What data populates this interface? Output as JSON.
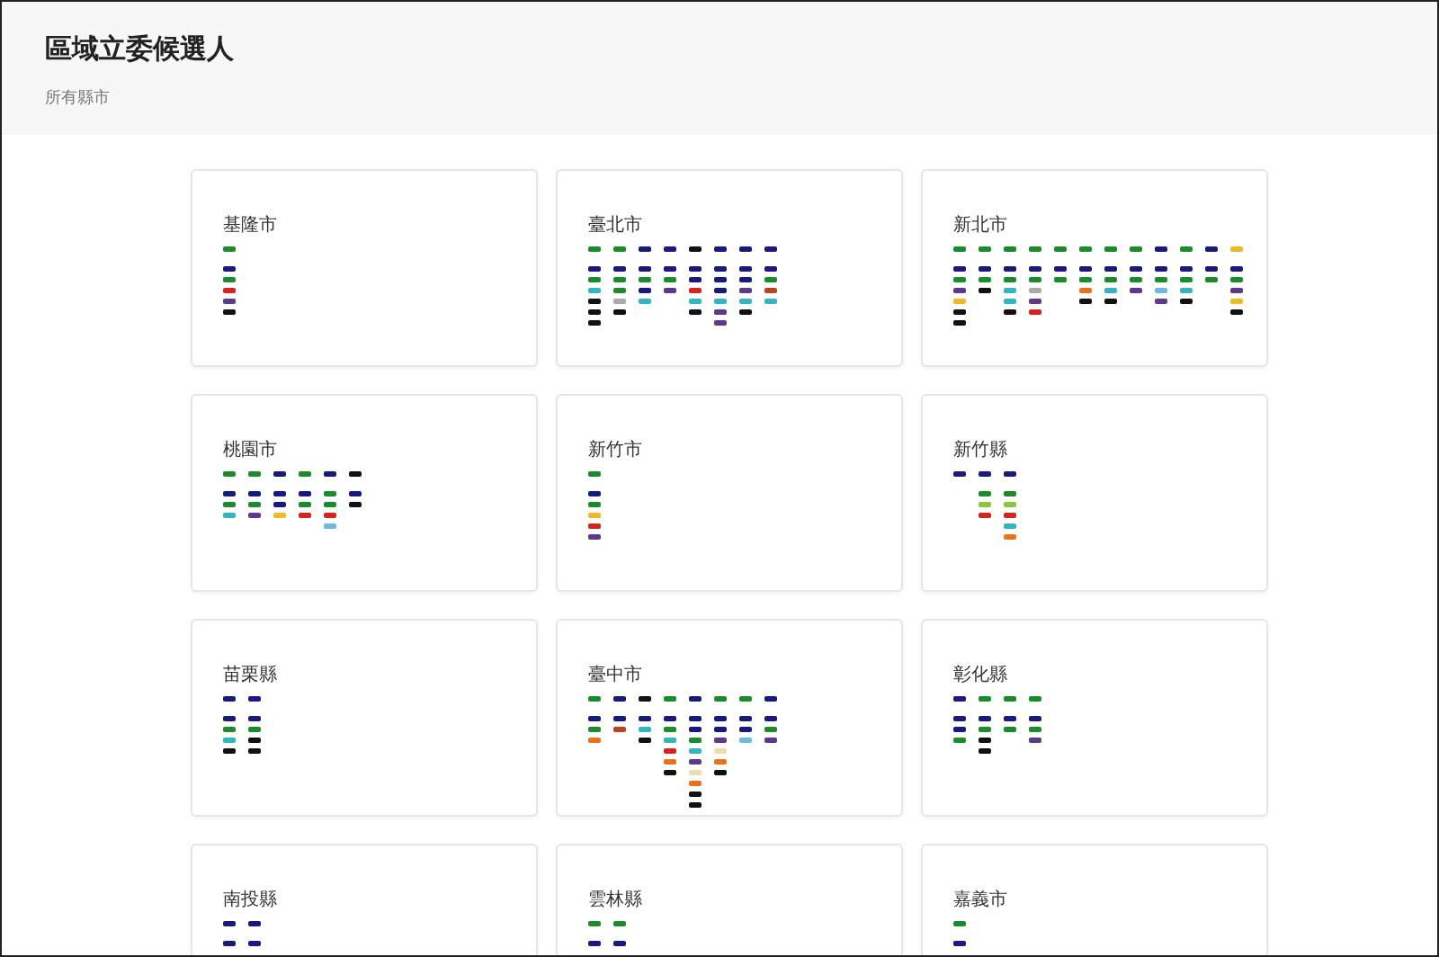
{
  "header": {
    "title": "區域立委候選人",
    "subtitle": "所有縣市"
  },
  "regions": [
    {
      "name": "基隆市",
      "columns": [
        [
          {
            "color": "#1e8a2e"
          },
          {
            "color": "#1a1a7a"
          },
          {
            "color": "#1e8a2e"
          },
          {
            "color": "#d0261d"
          },
          {
            "color": "#5b3a8c"
          },
          {
            "color": "#111111"
          }
        ]
      ]
    },
    {
      "name": "臺北市",
      "columns": [
        [
          {
            "color": "#1e8a2e"
          },
          {
            "color": "#1a1a7a"
          },
          {
            "color": "#1e8a2e"
          },
          {
            "color": "#35b5c0"
          },
          {
            "color": "#111111"
          },
          {
            "color": "#111111"
          },
          {
            "color": "#111111"
          }
        ],
        [
          {
            "color": "#1e8a2e"
          },
          {
            "color": "#1a1a7a"
          },
          {
            "color": "#1e8a2e"
          },
          {
            "color": "#1e8a2e"
          },
          {
            "color": "#aaaaaa"
          },
          {
            "color": "#111111"
          }
        ],
        [
          {
            "color": "#1a1a7a"
          },
          {
            "color": "#1a1a7a"
          },
          {
            "color": "#1e8a2e"
          },
          {
            "color": "#1a1a7a"
          },
          {
            "color": "#35b5c0"
          }
        ],
        [
          {
            "color": "#1a1a7a"
          },
          {
            "color": "#1a1a7a"
          },
          {
            "color": "#1e8a2e"
          },
          {
            "color": "#5b3a8c"
          }
        ],
        [
          {
            "color": "#111111"
          },
          {
            "color": "#1a1a7a"
          },
          {
            "color": "#1a1a7a"
          },
          {
            "color": "#d0261d"
          },
          {
            "color": "#35b5c0"
          },
          {
            "color": "#111111"
          }
        ],
        [
          {
            "color": "#1a1a7a"
          },
          {
            "color": "#1a1a7a"
          },
          {
            "color": "#1a1a7a"
          },
          {
            "color": "#1a1a7a"
          },
          {
            "color": "#35b5c0"
          },
          {
            "color": "#5b3a8c"
          },
          {
            "color": "#5b3a8c"
          }
        ],
        [
          {
            "color": "#1a1a7a"
          },
          {
            "color": "#1a1a7a"
          },
          {
            "color": "#1a1a7a"
          },
          {
            "color": "#5b3a8c"
          },
          {
            "color": "#35b5c0"
          },
          {
            "color": "#111111"
          }
        ],
        [
          {
            "color": "#1a1a7a"
          },
          {
            "color": "#1a1a7a"
          },
          {
            "color": "#1e8a2e"
          },
          {
            "color": "#b5471f"
          },
          {
            "color": "#35b5c0"
          }
        ]
      ]
    },
    {
      "name": "新北市",
      "columns": [
        [
          {
            "color": "#1e8a2e"
          },
          {
            "color": "#1a1a7a"
          },
          {
            "color": "#1e8a2e"
          },
          {
            "color": "#5b3a8c"
          },
          {
            "color": "#f0b92a"
          },
          {
            "color": "#111111"
          },
          {
            "color": "#111111"
          }
        ],
        [
          {
            "color": "#1e8a2e"
          },
          {
            "color": "#1a1a7a"
          },
          {
            "color": "#1e8a2e"
          },
          {
            "color": "#111111"
          }
        ],
        [
          {
            "color": "#1e8a2e"
          },
          {
            "color": "#1a1a7a"
          },
          {
            "color": "#1e8a2e"
          },
          {
            "color": "#35b5c0"
          },
          {
            "color": "#35b5c0"
          },
          {
            "color": "#111111"
          }
        ],
        [
          {
            "color": "#1e8a2e"
          },
          {
            "color": "#1a1a7a"
          },
          {
            "color": "#1e8a2e"
          },
          {
            "color": "#aaaaaa"
          },
          {
            "color": "#5b3a8c"
          },
          {
            "color": "#d0261d"
          }
        ],
        [
          {
            "color": "#1e8a2e"
          },
          {
            "color": "#1a1a7a"
          },
          {
            "color": "#1e8a2e"
          }
        ],
        [
          {
            "color": "#1e8a2e"
          },
          {
            "color": "#1a1a7a"
          },
          {
            "color": "#1e8a2e"
          },
          {
            "color": "#e8731f"
          },
          {
            "color": "#111111"
          }
        ],
        [
          {
            "color": "#1e8a2e"
          },
          {
            "color": "#1a1a7a"
          },
          {
            "color": "#1e8a2e"
          },
          {
            "color": "#35b5c0"
          },
          {
            "color": "#111111"
          }
        ],
        [
          {
            "color": "#1e8a2e"
          },
          {
            "color": "#1a1a7a"
          },
          {
            "color": "#1e8a2e"
          },
          {
            "color": "#5b3a8c"
          }
        ],
        [
          {
            "color": "#1a1a7a"
          },
          {
            "color": "#1a1a7a"
          },
          {
            "color": "#1e8a2e"
          },
          {
            "color": "#6fb8e0"
          },
          {
            "color": "#5b3a8c"
          }
        ],
        [
          {
            "color": "#1e8a2e"
          },
          {
            "color": "#1a1a7a"
          },
          {
            "color": "#1e8a2e"
          },
          {
            "color": "#35b5c0"
          },
          {
            "color": "#111111"
          }
        ],
        [
          {
            "color": "#1a1a7a"
          },
          {
            "color": "#1a1a7a"
          },
          {
            "color": "#1e8a2e"
          }
        ],
        [
          {
            "color": "#f0b92a"
          },
          {
            "color": "#1a1a7a"
          },
          {
            "color": "#1e8a2e"
          },
          {
            "color": "#5b3a8c"
          },
          {
            "color": "#f0b92a"
          },
          {
            "color": "#111111"
          }
        ]
      ]
    },
    {
      "name": "桃園市",
      "columns": [
        [
          {
            "color": "#1e8a2e"
          },
          {
            "color": "#1a1a7a"
          },
          {
            "color": "#1e8a2e"
          },
          {
            "color": "#35b5c0"
          }
        ],
        [
          {
            "color": "#1e8a2e"
          },
          {
            "color": "#1a1a7a"
          },
          {
            "color": "#1e8a2e"
          },
          {
            "color": "#5b3a8c"
          }
        ],
        [
          {
            "color": "#1a1a7a"
          },
          {
            "color": "#1a1a7a"
          },
          {
            "color": "#1a1a7a"
          },
          {
            "color": "#f0b92a"
          }
        ],
        [
          {
            "color": "#1e8a2e"
          },
          {
            "color": "#1a1a7a"
          },
          {
            "color": "#1e8a2e"
          },
          {
            "color": "#d0261d"
          }
        ],
        [
          {
            "color": "#1a1a7a"
          },
          {
            "color": "#1e8a2e"
          },
          {
            "color": "#1e8a2e"
          },
          {
            "color": "#d0261d"
          },
          {
            "color": "#6fb8e0"
          }
        ],
        [
          {
            "color": "#111111"
          },
          {
            "color": "#1a1a7a"
          },
          {
            "color": "#111111"
          }
        ]
      ]
    },
    {
      "name": "新竹市",
      "columns": [
        [
          {
            "color": "#1e8a2e"
          },
          {
            "color": "#1a1a7a"
          },
          {
            "color": "#1e8a2e"
          },
          {
            "color": "#f0b92a"
          },
          {
            "color": "#d0261d"
          },
          {
            "color": "#5b3a8c"
          }
        ]
      ]
    },
    {
      "name": "新竹縣",
      "columns": [
        [
          {
            "color": "#1a1a7a"
          }
        ],
        [
          {
            "color": "#1a1a7a"
          },
          {
            "color": "#1e8a2e"
          },
          {
            "color": "#8cc63f"
          },
          {
            "color": "#d0261d"
          }
        ],
        [
          {
            "color": "#1a1a7a"
          },
          {
            "color": "#1e8a2e"
          },
          {
            "color": "#8cc63f"
          },
          {
            "color": "#d0261d"
          },
          {
            "color": "#35b5c0"
          },
          {
            "color": "#e8731f"
          }
        ]
      ]
    },
    {
      "name": "苗栗縣",
      "columns": [
        [
          {
            "color": "#1a1a7a"
          },
          {
            "color": "#1a1a7a"
          },
          {
            "color": "#1e8a2e"
          },
          {
            "color": "#35b5c0"
          },
          {
            "color": "#111111"
          }
        ],
        [
          {
            "color": "#1a1a7a"
          },
          {
            "color": "#1a1a7a"
          },
          {
            "color": "#1e8a2e"
          },
          {
            "color": "#111111"
          },
          {
            "color": "#111111"
          }
        ]
      ]
    },
    {
      "name": "臺中市",
      "columns": [
        [
          {
            "color": "#1e8a2e"
          },
          {
            "color": "#1a1a7a"
          },
          {
            "color": "#1e8a2e"
          },
          {
            "color": "#e8731f"
          }
        ],
        [
          {
            "color": "#1a1a7a"
          },
          {
            "color": "#1a1a7a"
          },
          {
            "color": "#b5471f"
          }
        ],
        [
          {
            "color": "#111111"
          },
          {
            "color": "#1a1a7a"
          },
          {
            "color": "#35b5c0"
          },
          {
            "color": "#111111"
          }
        ],
        [
          {
            "color": "#1e8a2e"
          },
          {
            "color": "#1a1a7a"
          },
          {
            "color": "#1e8a2e"
          },
          {
            "color": "#35b5c0"
          },
          {
            "color": "#d0261d"
          },
          {
            "color": "#e8731f"
          },
          {
            "color": "#111111"
          }
        ],
        [
          {
            "color": "#1a1a7a"
          },
          {
            "color": "#1a1a7a"
          },
          {
            "color": "#1a1a7a"
          },
          {
            "color": "#1e8a2e"
          },
          {
            "color": "#35b5c0"
          },
          {
            "color": "#5b3a8c"
          },
          {
            "color": "#f0dcb0"
          },
          {
            "color": "#e8731f"
          },
          {
            "color": "#111111"
          },
          {
            "color": "#111111"
          }
        ],
        [
          {
            "color": "#1e8a2e"
          },
          {
            "color": "#1a1a7a"
          },
          {
            "color": "#1a1a7a"
          },
          {
            "color": "#5b3a8c"
          },
          {
            "color": "#f0dcb0"
          },
          {
            "color": "#e8731f"
          },
          {
            "color": "#111111"
          }
        ],
        [
          {
            "color": "#1e8a2e"
          },
          {
            "color": "#1a1a7a"
          },
          {
            "color": "#1a1a7a"
          },
          {
            "color": "#6fb8e0"
          }
        ],
        [
          {
            "color": "#1a1a7a"
          },
          {
            "color": "#1a1a7a"
          },
          {
            "color": "#1e8a2e"
          },
          {
            "color": "#5b3a8c"
          }
        ]
      ]
    },
    {
      "name": "彰化縣",
      "columns": [
        [
          {
            "color": "#1a1a7a"
          },
          {
            "color": "#1a1a7a"
          },
          {
            "color": "#1a1a7a"
          },
          {
            "color": "#1e8a2e"
          }
        ],
        [
          {
            "color": "#1e8a2e"
          },
          {
            "color": "#1a1a7a"
          },
          {
            "color": "#1e8a2e"
          },
          {
            "color": "#111111"
          },
          {
            "color": "#111111"
          }
        ],
        [
          {
            "color": "#1e8a2e"
          },
          {
            "color": "#1a1a7a"
          },
          {
            "color": "#1e8a2e"
          }
        ],
        [
          {
            "color": "#1e8a2e"
          },
          {
            "color": "#1a1a7a"
          },
          {
            "color": "#1e8a2e"
          },
          {
            "color": "#5b3a8c"
          }
        ]
      ]
    },
    {
      "name": "南投縣",
      "columns": [
        [
          {
            "color": "#1a1a7a"
          },
          {
            "color": "#1a1a7a"
          }
        ],
        [
          {
            "color": "#1a1a7a"
          },
          {
            "color": "#1a1a7a"
          }
        ]
      ]
    },
    {
      "name": "雲林縣",
      "columns": [
        [
          {
            "color": "#1e8a2e"
          },
          {
            "color": "#1a1a7a"
          }
        ],
        [
          {
            "color": "#1e8a2e"
          },
          {
            "color": "#1a1a7a"
          }
        ]
      ]
    },
    {
      "name": "嘉義市",
      "columns": [
        [
          {
            "color": "#1e8a2e"
          },
          {
            "color": "#1a1a7a"
          }
        ]
      ]
    }
  ]
}
